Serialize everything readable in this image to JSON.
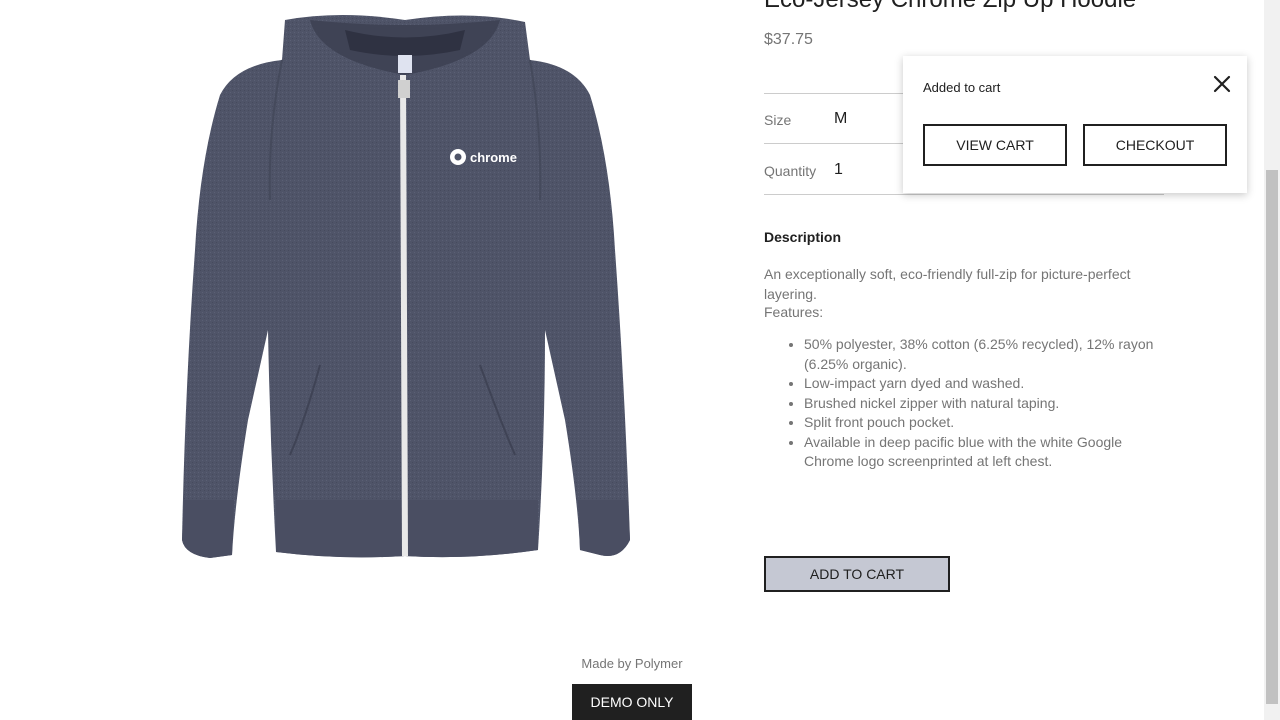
{
  "product": {
    "title": "Eco-Jersey Chrome Zip Up Hoodie",
    "price": "$37.75",
    "size_label": "Size",
    "size_value": "M",
    "quantity_label": "Quantity",
    "quantity_value": "1",
    "image_logo_text": "chrome",
    "color": "#4f5468"
  },
  "description": {
    "heading": "Description",
    "text": "An exceptionally soft, eco-friendly full-zip for picture-perfect layering.",
    "features_label": "Features:",
    "features": [
      "50% polyester, 38% cotton (6.25% recycled), 12% rayon (6.25% organic).",
      "Low-impact yarn dyed and washed.",
      "Brushed nickel zipper with natural taping.",
      "Split front pouch pocket.",
      "Available in deep pacific blue with the white Google Chrome logo screenprinted at left chest."
    ]
  },
  "actions": {
    "add_to_cart": "ADD TO CART"
  },
  "popup": {
    "label": "Added to cart",
    "view_cart": "VIEW CART",
    "checkout": "CHECKOUT",
    "close_icon": "close-icon"
  },
  "footer": {
    "made_by": "Made by Polymer",
    "demo_only": "DEMO ONLY"
  }
}
